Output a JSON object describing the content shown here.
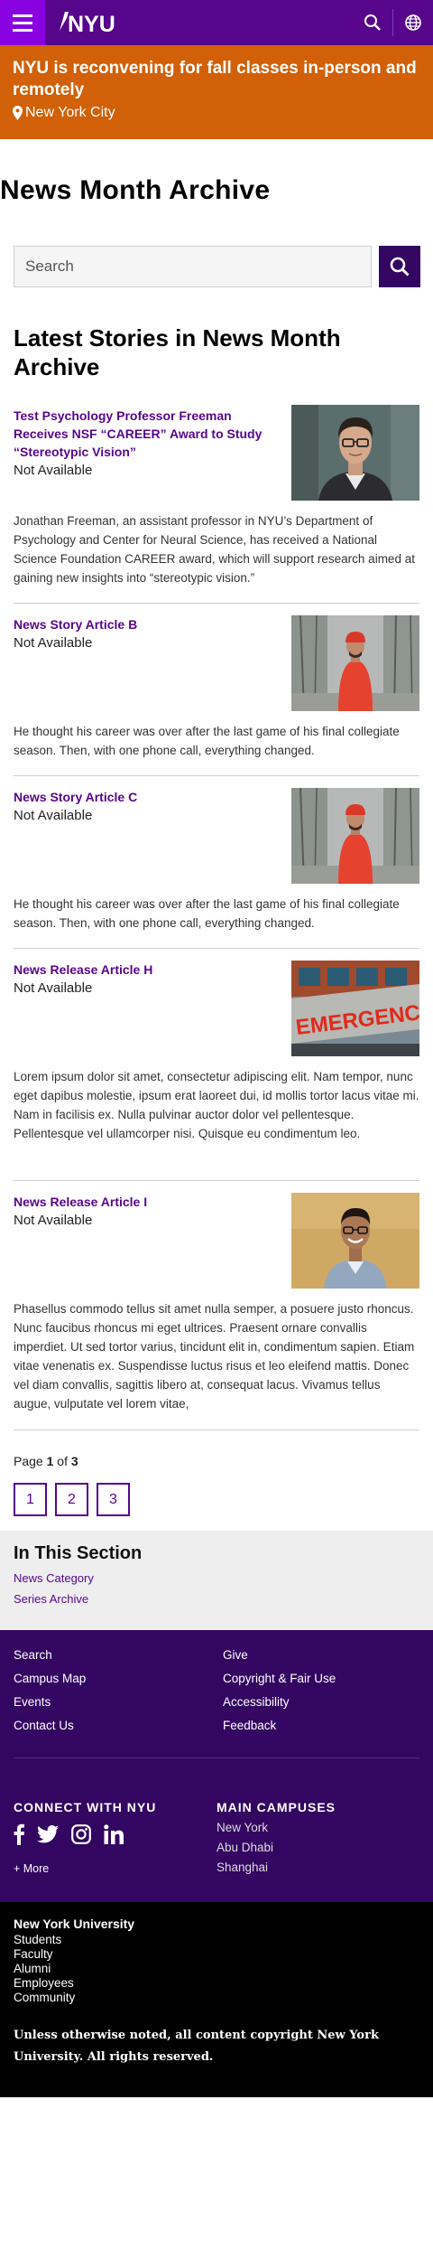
{
  "header": {
    "logo_text": "NYU",
    "brand_color": "#57068c",
    "accent_color": "#8900e1"
  },
  "alert": {
    "title": "NYU is reconvening for fall classes in-person and remotely",
    "location": "New York City",
    "color": "#d16008"
  },
  "page": {
    "title": "News Month Archive"
  },
  "search": {
    "placeholder": "Search"
  },
  "latest": {
    "heading": "Latest Stories in News Month Archive",
    "articles": [
      {
        "title": "Test Psychology Professor Freeman Receives NSF “CAREER” Award to Study “Stereotypic Vision”",
        "date": "Not Available",
        "summary": "Jonathan Freeman, an assistant professor in NYU’s Department of Psychology and Center for Neural Science, has received a National Science Foundation CAREER award, which will support research aimed at gaining new insights into “stereotypic vision.”"
      },
      {
        "title": "News Story Article B",
        "date": "Not Available",
        "summary": "He thought his career was over after the last game of his final collegiate season. Then, with one phone call, everything changed."
      },
      {
        "title": "News Story Article C",
        "date": "Not Available",
        "summary": "He thought his career was over after the last game of his final collegiate season. Then, with one phone call, everything changed."
      },
      {
        "title": "News Release Article H",
        "date": "Not Available",
        "summary": "Lorem ipsum dolor sit amet, consectetur adipiscing elit. Nam tempor, nunc eget dapibus molestie, ipsum erat laoreet dui, id mollis tortor lacus vitae mi. Nam in facilisis ex. Nulla pulvinar auctor dolor vel pellentesque. Pellentesque vel ullamcorper nisi. Quisque eu condimentum leo."
      },
      {
        "title": "News Release Article I",
        "date": "Not Available",
        "summary": "Phasellus commodo tellus sit amet nulla semper, a posuere justo rhoncus. Nunc faucibus rhoncus mi eget ultrices. Praesent ornare convallis imperdiet. Ut sed tortor varius, tincidunt elit in, condimentum sapien. Etiam vitae venenatis ex. Suspendisse luctus risus et leo eleifend mattis. Donec vel diam convallis, sagittis libero at, consequat lacus. Vivamus tellus augue, vulputate vel lorem vitae,"
      }
    ],
    "thumb_sign_text": "EMERGENCY"
  },
  "pagination": {
    "page_word": "Page",
    "current": "1",
    "of_word": "of",
    "total": "3",
    "pages": [
      "1",
      "2",
      "3"
    ]
  },
  "in_section": {
    "title": "In This Section",
    "links": [
      "News Category",
      "Series Archive"
    ]
  },
  "footer": {
    "links_left": [
      "Search",
      "Campus Map",
      "Events",
      "Contact Us"
    ],
    "links_right": [
      "Give",
      "Copyright & Fair Use",
      "Accessibility",
      "Feedback"
    ],
    "connect_label": "CONNECT WITH NYU",
    "more_label": "+ More",
    "campuses_label": "MAIN CAMPUSES",
    "campuses": [
      "New York",
      "Abu Dhabi",
      "Shanghai"
    ],
    "university": "New York University",
    "audience_links": [
      "Students",
      "Faculty",
      "Alumni",
      "Employees",
      "Community"
    ],
    "copyright": "Unless otherwise noted, all content copyright New York University. All rights reserved.",
    "footer_color": "#330662"
  }
}
